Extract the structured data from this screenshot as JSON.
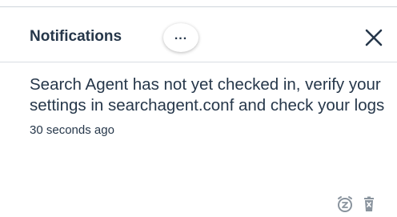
{
  "header": {
    "title": "Notifications",
    "more_label": "...",
    "close_icon": "close-icon"
  },
  "notification": {
    "message": "Search Agent has not yet checked in, verify your settings in searchagent.conf and check your logs",
    "timestamp": "30 seconds ago",
    "actions": {
      "snooze_icon": "snooze-alarm-icon",
      "delete_icon": "trash-icon"
    }
  },
  "colors": {
    "text": "#26374a",
    "icon_muted": "#8a949e",
    "divider": "#d9dee3"
  }
}
